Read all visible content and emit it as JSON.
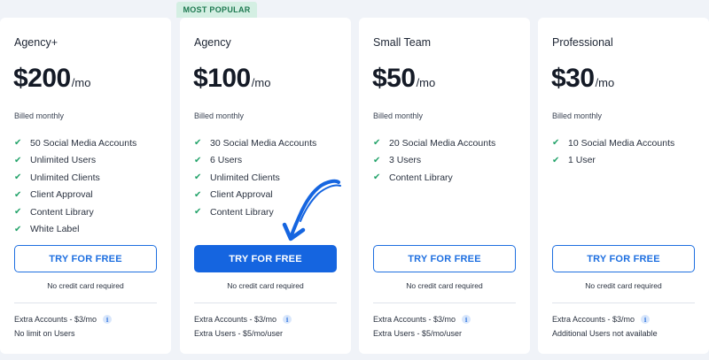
{
  "badge": {
    "label": "MOST POPULAR"
  },
  "colors": {
    "accent": "#1565e0",
    "check": "#23a36a",
    "badge_bg": "#d4efe3"
  },
  "plans": [
    {
      "name": "Agency+",
      "price": "$200",
      "period": "/mo",
      "billed": "Billed monthly",
      "features": [
        "50 Social Media Accounts",
        "Unlimited Users",
        "Unlimited Clients",
        "Client Approval",
        "Content Library",
        "White Label"
      ],
      "cta": "TRY FOR FREE",
      "note": "No credit card required",
      "extra_accounts": "Extra Accounts - $3/mo",
      "extra_users": "No limit on Users"
    },
    {
      "name": "Agency",
      "price": "$100",
      "period": "/mo",
      "billed": "Billed monthly",
      "features": [
        "30 Social Media Accounts",
        "6 Users",
        "Unlimited Clients",
        "Client Approval",
        "Content Library"
      ],
      "cta": "TRY FOR FREE",
      "note": "No credit card required",
      "extra_accounts": "Extra Accounts - $3/mo",
      "extra_users": "Extra Users - $5/mo/user"
    },
    {
      "name": "Small Team",
      "price": "$50",
      "period": "/mo",
      "billed": "Billed monthly",
      "features": [
        "20 Social Media Accounts",
        "3 Users",
        "Content Library"
      ],
      "cta": "TRY FOR FREE",
      "note": "No credit card required",
      "extra_accounts": "Extra Accounts - $3/mo",
      "extra_users": "Extra Users - $5/mo/user"
    },
    {
      "name": "Professional",
      "price": "$30",
      "period": "/mo",
      "billed": "Billed monthly",
      "features": [
        "10 Social Media Accounts",
        "1 User"
      ],
      "cta": "TRY FOR FREE",
      "note": "No credit card required",
      "extra_accounts": "Extra Accounts - $3/mo",
      "extra_users": "Additional Users not available"
    }
  ],
  "icons": {
    "check": "check-icon",
    "info": "info-icon",
    "arrow": "arrow-annotation"
  }
}
